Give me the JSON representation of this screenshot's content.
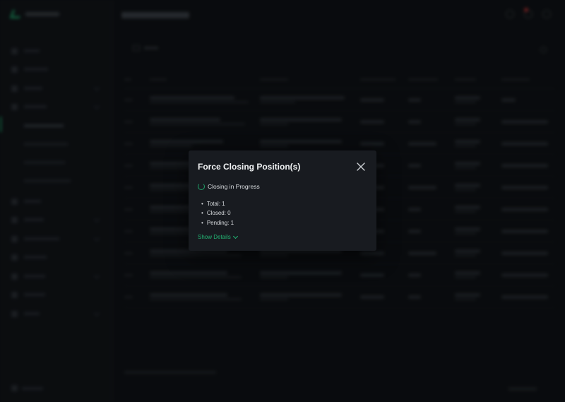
{
  "modal": {
    "title": "Force Closing Position(s)",
    "status": "Closing in Progress",
    "stats": [
      "Total: 1",
      "Closed: 0",
      "Pending: 1"
    ],
    "show_details": "Show Details",
    "close_icon": "close-icon",
    "spinner_icon": "spinner-icon"
  },
  "colors": {
    "accent": "#22b473",
    "modal_bg": "#181b20",
    "page_bg": "#0f1216"
  }
}
